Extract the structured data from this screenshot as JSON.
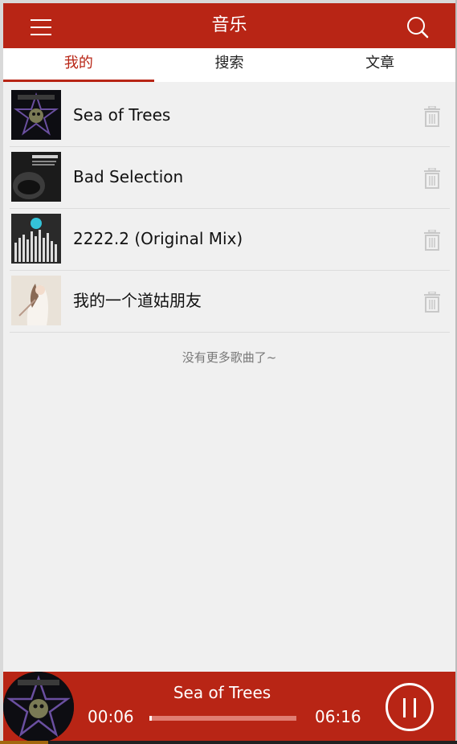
{
  "header": {
    "title": "音乐",
    "menu_icon": "hamburger-menu-icon",
    "search_icon": "search-icon",
    "bg_color": "#b82515"
  },
  "tabs": [
    {
      "label": "我的",
      "active": true
    },
    {
      "label": "搜索",
      "active": false
    },
    {
      "label": "文章",
      "active": false
    }
  ],
  "songs": [
    {
      "title": "Sea of Trees"
    },
    {
      "title": "Bad Selection"
    },
    {
      "title": "2222.2 (Original Mix)"
    },
    {
      "title": "我的一个道姑朋友"
    }
  ],
  "list_footer": "没有更多歌曲了~",
  "player": {
    "title": "Sea of Trees",
    "current_time": "00:06",
    "total_time": "06:16",
    "progress": 0.016,
    "state": "playing",
    "control_icon": "pause-icon"
  },
  "colors": {
    "accent": "#b82515",
    "list_bg": "#f0f0f0"
  }
}
